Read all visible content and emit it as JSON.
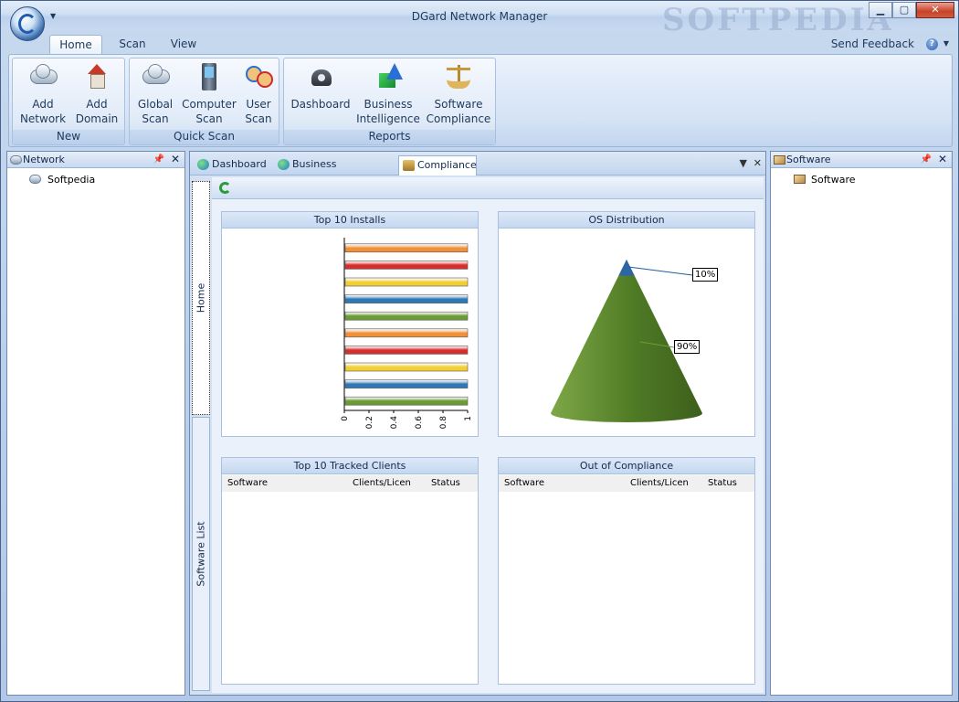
{
  "window": {
    "title": "DGard Network Manager",
    "watermark": "SOFTPEDIA",
    "controls": {
      "minimize": "▁",
      "maximize": "▢",
      "close": "✕"
    }
  },
  "ribbon": {
    "tabs": [
      {
        "label": "Home",
        "active": true
      },
      {
        "label": "Scan",
        "active": false
      },
      {
        "label": "View",
        "active": false
      }
    ],
    "send_feedback": "Send Feedback",
    "help_glyph": "?",
    "groups": [
      {
        "label": "New",
        "buttons": [
          {
            "line1": "Add",
            "line2": "Network",
            "icon": "cloud-icon"
          },
          {
            "line1": "Add",
            "line2": "Domain",
            "icon": "house-icon"
          }
        ]
      },
      {
        "label": "Quick Scan",
        "buttons": [
          {
            "line1": "Global",
            "line2": "Scan",
            "icon": "cloud-icon"
          },
          {
            "line1": "Computer",
            "line2": "Scan",
            "icon": "computer-icon"
          },
          {
            "line1": "User",
            "line2": "Scan",
            "icon": "users-icon"
          }
        ]
      },
      {
        "label": "Reports",
        "buttons": [
          {
            "line1": "Dashboard",
            "line2": "",
            "icon": "dashboard-icon"
          },
          {
            "line1": "Business",
            "line2": "Intelligence",
            "icon": "bi-icon"
          },
          {
            "line1": "Software",
            "line2": "Compliance",
            "icon": "scale-icon"
          }
        ]
      }
    ]
  },
  "network_panel": {
    "title": "Network",
    "items": [
      "Softpedia"
    ]
  },
  "software_panel": {
    "title": "Software",
    "items": [
      "Software"
    ]
  },
  "doc_tabs": [
    {
      "label": "Dashboard",
      "active": false
    },
    {
      "label": "Business Intelligence",
      "active": false
    },
    {
      "label": "Compliance",
      "active": true
    }
  ],
  "side_tabs": [
    {
      "label": "Home",
      "active": true
    },
    {
      "label": "Software List",
      "active": false
    }
  ],
  "cards": {
    "top_installs": {
      "title": "Top 10 Installs"
    },
    "os_distribution": {
      "title": "OS Distribution"
    },
    "tracked_clients": {
      "title": "Top 10 Tracked Clients",
      "columns": [
        "Software",
        "Clients/Licen",
        "Status"
      ]
    },
    "out_of_compliance": {
      "title": "Out of Compliance",
      "columns": [
        "Software",
        "Clients/Licen",
        "Status"
      ]
    }
  },
  "chart_data": [
    {
      "type": "bar",
      "orientation": "horizontal",
      "title": "Top 10 Installs",
      "categories": [
        "",
        "",
        "",
        "",
        "",
        "",
        "",
        "",
        "",
        ""
      ],
      "values": [
        1,
        1,
        1,
        1,
        1,
        1,
        1,
        1,
        1,
        1
      ],
      "colors": [
        "#f0913a",
        "#d62d2d",
        "#f0cf34",
        "#2f78b8",
        "#6a9b35",
        "#f0913a",
        "#d62d2d",
        "#f0cf34",
        "#2f78b8",
        "#6a9b35"
      ],
      "xticks": [
        "0",
        "0.2",
        "0.4",
        "0.6",
        "0.8",
        "1"
      ],
      "xlim": [
        0,
        1
      ]
    },
    {
      "type": "pie",
      "style": "cone",
      "title": "OS Distribution",
      "slices": [
        {
          "label": "10%",
          "value": 10,
          "color": "#2d66a5"
        },
        {
          "label": "90%",
          "value": 90,
          "color": "#4f7a25"
        }
      ]
    }
  ]
}
